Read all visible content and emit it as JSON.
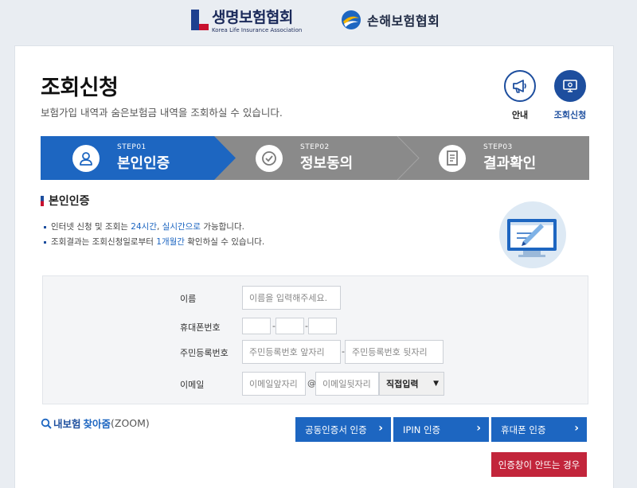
{
  "logos": {
    "life_ko": "생명보험협회",
    "life_en": "Korea Life Insurance Association",
    "nonlife_ko": "손해보험협회"
  },
  "page": {
    "title": "조회신청",
    "subtitle": "보험가입 내역과 숨은보험금 내역을 조회하실 수 있습니다."
  },
  "top_icons": {
    "guide_label": "안내",
    "request_label": "조회신청"
  },
  "steps": [
    {
      "num": "STEP01",
      "name": "본인인증",
      "active": true
    },
    {
      "num": "STEP02",
      "name": "정보동의",
      "active": false
    },
    {
      "num": "STEP03",
      "name": "결과확인",
      "active": false
    }
  ],
  "section": {
    "title": "본인인증",
    "bullet1_a": "인터넷 신청 및 조회는 ",
    "bullet1_hl1": "24시간",
    "bullet1_b": ", ",
    "bullet1_hl2": "실시간으로",
    "bullet1_c": " 가능합니다.",
    "bullet2_a": "조회결과는 조회신청일로부터 ",
    "bullet2_hl": "1개월간",
    "bullet2_b": " 확인하실 수 있습니다."
  },
  "form": {
    "name_label": "이름",
    "name_placeholder": "이름을 입력해주세요.",
    "phone_label": "휴대폰번호",
    "phone_sep": "-",
    "rrn_label": "주민등록번호",
    "rrn_front_placeholder": "주민등록번호 앞자리",
    "rrn_sep": "-",
    "rrn_back_placeholder": "주민등록번호 뒷자리",
    "email_label": "이메일",
    "email_front_placeholder": "이메일앞자리",
    "email_at": "@",
    "email_back_placeholder": "이메일뒷자리",
    "email_domain_selected": "직접입력"
  },
  "zoom": {
    "part1": "내보험",
    "part2": "찾아줌",
    "part3": "(ZOOM)"
  },
  "buttons": {
    "cert": "공동인증서 인증",
    "ipin": "IPIN 인증",
    "phone": "휴대폰 인증",
    "help": "인증창이 안뜨는 경우",
    "arrow": "›"
  },
  "colors": {
    "primary": "#1d66c1",
    "navy": "#1d4e9e",
    "step_inactive": "#8a8a8a",
    "danger": "#c2253b"
  }
}
